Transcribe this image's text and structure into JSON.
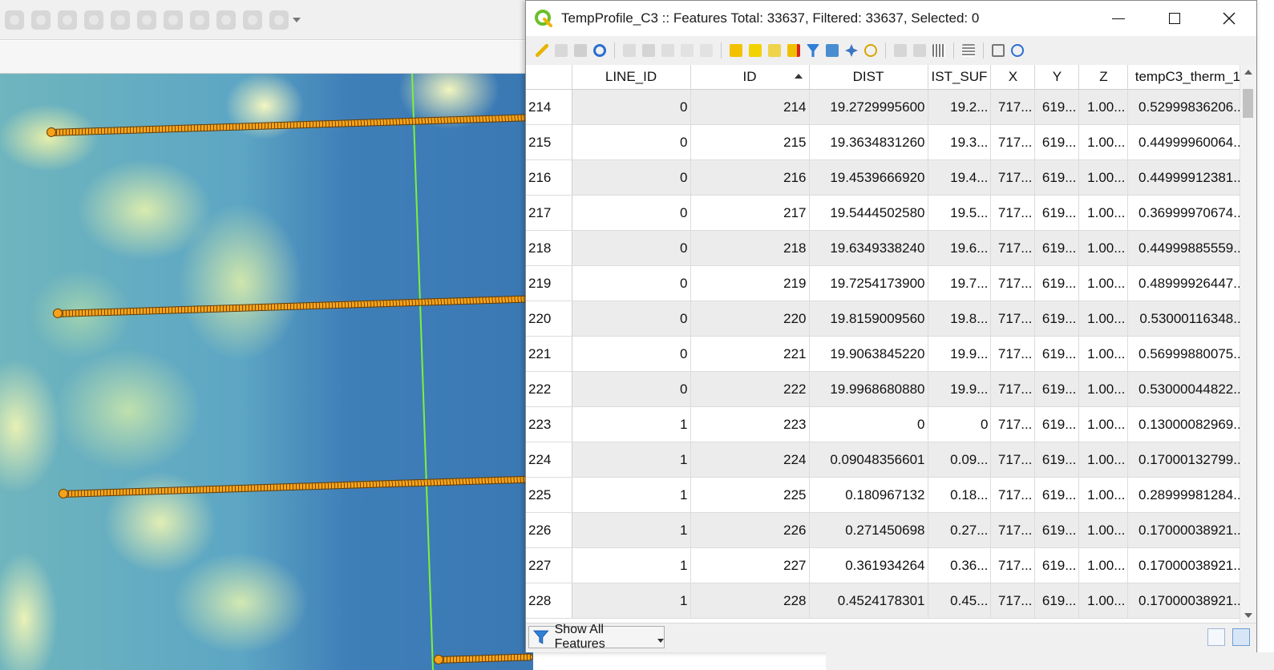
{
  "main_window": {
    "toolbar_icons": [
      "digitize-1",
      "digitize-2",
      "digitize-3",
      "digitize-4",
      "digitize-5",
      "digitize-6",
      "digitize-7",
      "digitize-8",
      "digitize-9",
      "digitize-10",
      "digitize-11"
    ]
  },
  "attribute_window": {
    "title": "TempProfile_C3 :: Features Total: 33637, Filtered: 33637, Selected: 0",
    "minimize_label": "—",
    "maximize_label": "☐",
    "close_label": "✕",
    "columns": [
      "",
      "LINE_ID",
      "ID",
      "DIST",
      "IST_SUF",
      "X",
      "Y",
      "Z",
      "tempC3_therm_1"
    ],
    "sorted_column": "ID",
    "rows": [
      [
        "214",
        "0",
        "214",
        "19.2729995600",
        "19.2...",
        "717...",
        "619...",
        "1.00...",
        "0.52999836206..."
      ],
      [
        "215",
        "0",
        "215",
        "19.3634831260",
        "19.3...",
        "717...",
        "619...",
        "1.00...",
        "0.44999960064..."
      ],
      [
        "216",
        "0",
        "216",
        "19.4539666920",
        "19.4...",
        "717...",
        "619...",
        "1.00...",
        "0.44999912381..."
      ],
      [
        "217",
        "0",
        "217",
        "19.5444502580",
        "19.5...",
        "717...",
        "619...",
        "1.00...",
        "0.36999970674..."
      ],
      [
        "218",
        "0",
        "218",
        "19.6349338240",
        "19.6...",
        "717...",
        "619...",
        "1.00...",
        "0.44999885559..."
      ],
      [
        "219",
        "0",
        "219",
        "19.7254173900",
        "19.7...",
        "717...",
        "619...",
        "1.00...",
        "0.48999926447..."
      ],
      [
        "220",
        "0",
        "220",
        "19.8159009560",
        "19.8...",
        "717...",
        "619...",
        "1.00...",
        "0.53000116348..."
      ],
      [
        "221",
        "0",
        "221",
        "19.9063845220",
        "19.9...",
        "717...",
        "619...",
        "1.00...",
        "0.56999880075..."
      ],
      [
        "222",
        "0",
        "222",
        "19.9968680880",
        "19.9...",
        "717...",
        "619...",
        "1.00...",
        "0.53000044822..."
      ],
      [
        "223",
        "1",
        "223",
        "0",
        "0",
        "717...",
        "619...",
        "1.00...",
        "0.13000082969..."
      ],
      [
        "224",
        "1",
        "224",
        "0.09048356601",
        "0.09...",
        "717...",
        "619...",
        "1.00...",
        "0.17000132799..."
      ],
      [
        "225",
        "1",
        "225",
        "0.180967132",
        "0.18...",
        "717...",
        "619...",
        "1.00...",
        "0.28999981284..."
      ],
      [
        "226",
        "1",
        "226",
        "0.271450698",
        "0.27...",
        "717...",
        "619...",
        "1.00...",
        "0.17000038921..."
      ],
      [
        "227",
        "1",
        "227",
        "0.361934264",
        "0.36...",
        "717...",
        "619...",
        "1.00...",
        "0.17000038921..."
      ],
      [
        "228",
        "1",
        "228",
        "0.4524178301",
        "0.45...",
        "717...",
        "619...",
        "1.00...",
        "0.17000038921..."
      ]
    ],
    "show_all_label": "Show All Features",
    "colors": {
      "accent_green": "#6bbf2a",
      "row_alt": "#ececec",
      "profile_point": "#f6a21a",
      "cut_line": "#7cf23a"
    }
  }
}
